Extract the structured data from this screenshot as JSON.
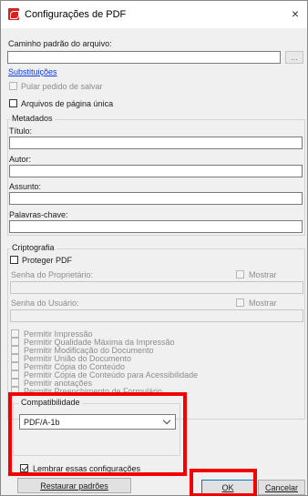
{
  "window": {
    "title": "Configurações de PDF",
    "close_glyph": "×",
    "icon": "acrobat-pdf-icon",
    "accent": "#d6231d"
  },
  "path": {
    "label": "Caminho padrão do arquivo:",
    "value": "",
    "browse_label": "...",
    "replace_link": "Substituições"
  },
  "options": {
    "skip_save_prompt": {
      "label": "Pular pedido de salvar",
      "checked": false,
      "enabled": false
    },
    "single_page_files": {
      "label": "Arquivos de página única",
      "checked": false,
      "enabled": true
    }
  },
  "metadata": {
    "title": "Metadados",
    "fields": [
      {
        "label": "Título:",
        "value": ""
      },
      {
        "label": "Autor:",
        "value": ""
      },
      {
        "label": "Assunto:",
        "value": ""
      },
      {
        "label": "Palavras-chave:",
        "value": ""
      }
    ]
  },
  "encryption": {
    "title": "Criptografia",
    "protect_label": "Proteger PDF",
    "owner_password_label": "Senha do Proprietário:",
    "user_password_label": "Senha do Usuário:",
    "show_label": "Mostrar",
    "permissions": [
      "Permitir Impressão",
      "Permitir Qualidade Máxima da Impressão",
      "Permitir Modificação do Documento",
      "Permitir União do Documento",
      "Permitir Cópia do Conteúdo",
      "Permitir Cópia de Conteúdo para Acessibilidade",
      "Permitir anotações",
      "Permitir Preenchimento de Formulário"
    ]
  },
  "compatibility": {
    "title": "Compatibilidade",
    "selected": "PDF/A-1b"
  },
  "remember": {
    "label": "Lembrar essas configurações",
    "checked": true
  },
  "buttons": {
    "restore": "Restaurar padrões",
    "ok": "OK",
    "cancel": "Cancelar"
  },
  "highlight_color": "#f40000"
}
